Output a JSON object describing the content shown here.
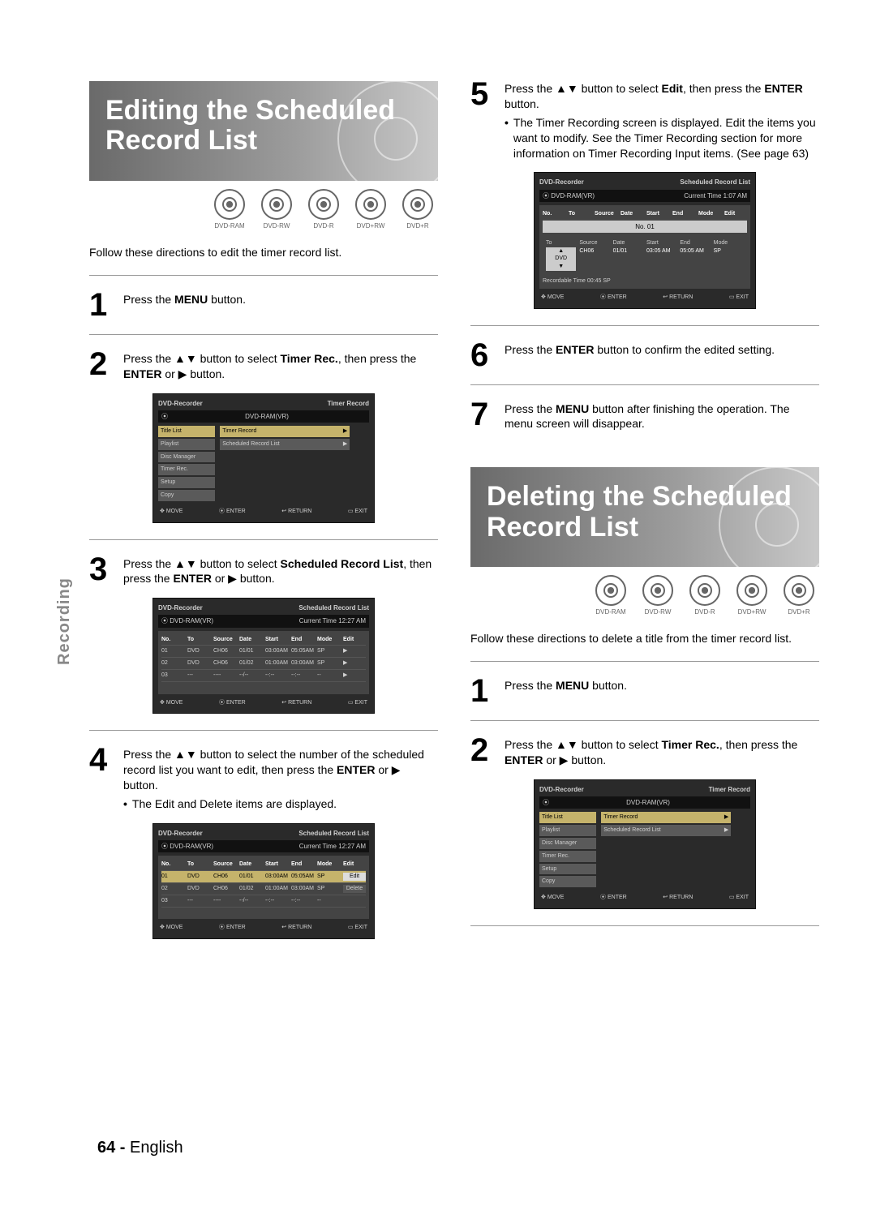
{
  "tab_label": "Recording",
  "footer": {
    "page": "64 -",
    "lang": "English"
  },
  "disc_types": [
    "DVD-RAM",
    "DVD-RW",
    "DVD-R",
    "DVD+RW",
    "DVD+R"
  ],
  "osd_common": {
    "device": "DVD-Recorder",
    "disc": "DVD-RAM(VR)",
    "cols": [
      "No.",
      "To",
      "Source",
      "Date",
      "Start",
      "End",
      "Mode",
      "Edit"
    ],
    "footer": [
      "MOVE",
      "ENTER",
      "RETURN",
      "EXIT"
    ]
  },
  "menu_items": [
    "Title List",
    "Playlist",
    "Disc Manager",
    "Timer Rec.",
    "Setup",
    "Copy"
  ],
  "sec1": {
    "title": "Editing the Scheduled Record List",
    "intro": "Follow these directions to edit the timer record list.",
    "step1": "Press the MENU button.",
    "step2": "Press the ▲▼ button to select Timer Rec., then press the ENTER or ▶ button.",
    "step3": "Press the ▲▼ button to select Scheduled Record List, then press the ENTER or ▶ button.",
    "step4_a": "Press the ▲▼ button to select the number of the scheduled record list you want to edit, then press the ENTER or ▶ button.",
    "step4_b": "The Edit and Delete items are displayed.",
    "step5_a": "Press the ▲▼ button to select Edit, then press the ENTER button.",
    "step5_b": "The Timer Recording screen is displayed. Edit the items you want to modify. See the Timer Recording section for more information on Timer Recording Input items. (See page 63)",
    "step6": "Press the ENTER button to confirm the edited setting.",
    "step7": "Press the MENU button after finishing the operation. The menu screen will disappear.",
    "osd2": {
      "title_right": "Timer Record",
      "right_items": [
        "Timer Record",
        "Scheduled Record List"
      ]
    },
    "osd3": {
      "title_right": "Scheduled Record List",
      "current_time": "Current Time  12:27 AM",
      "rows": [
        [
          "01",
          "DVD",
          "CH06",
          "01/01",
          "03:00AM",
          "05:05AM",
          "SP",
          "▶"
        ],
        [
          "02",
          "DVD",
          "CH06",
          "01/02",
          "01:00AM",
          "03:00AM",
          "SP",
          "▶"
        ],
        [
          "03",
          "---",
          "----",
          "--/--",
          "--:--",
          "--:--",
          "--",
          "▶"
        ]
      ]
    },
    "osd4": {
      "title_right": "Scheduled Record List",
      "current_time": "Current Time  12:27 AM",
      "rows": [
        [
          "01",
          "DVD",
          "CH06",
          "01/01",
          "03:00AM",
          "05:05AM",
          "SP",
          "Edit"
        ],
        [
          "02",
          "DVD",
          "CH06",
          "01/02",
          "01:00AM",
          "03:00AM",
          "SP",
          "Delete"
        ],
        [
          "03",
          "---",
          "----",
          "--/--",
          "--:--",
          "--:--",
          "--",
          ""
        ]
      ]
    },
    "osd5": {
      "title_right": "Scheduled Record List",
      "current_time": "Current Time  1:07 AM",
      "no_label": "No. 01",
      "prow_head": [
        "To",
        "Source",
        "Date",
        "Start",
        "End",
        "Mode"
      ],
      "prow_vals": [
        "DVD",
        "CH06",
        "01/01",
        "03:05 AM",
        "05:05 AM",
        "SP"
      ],
      "rec_time": "Recordable Time   00:45  SP"
    }
  },
  "sec2": {
    "title": "Deleting the Scheduled Record List",
    "intro": "Follow these directions to delete a title from the timer record list.",
    "step1": "Press the MENU button.",
    "step2": "Press the ▲▼ button to select Timer Rec., then press the ENTER or ▶ button.",
    "osd": {
      "title_right": "Timer Record",
      "right_items": [
        "Timer Record",
        "Scheduled Record List"
      ]
    }
  }
}
